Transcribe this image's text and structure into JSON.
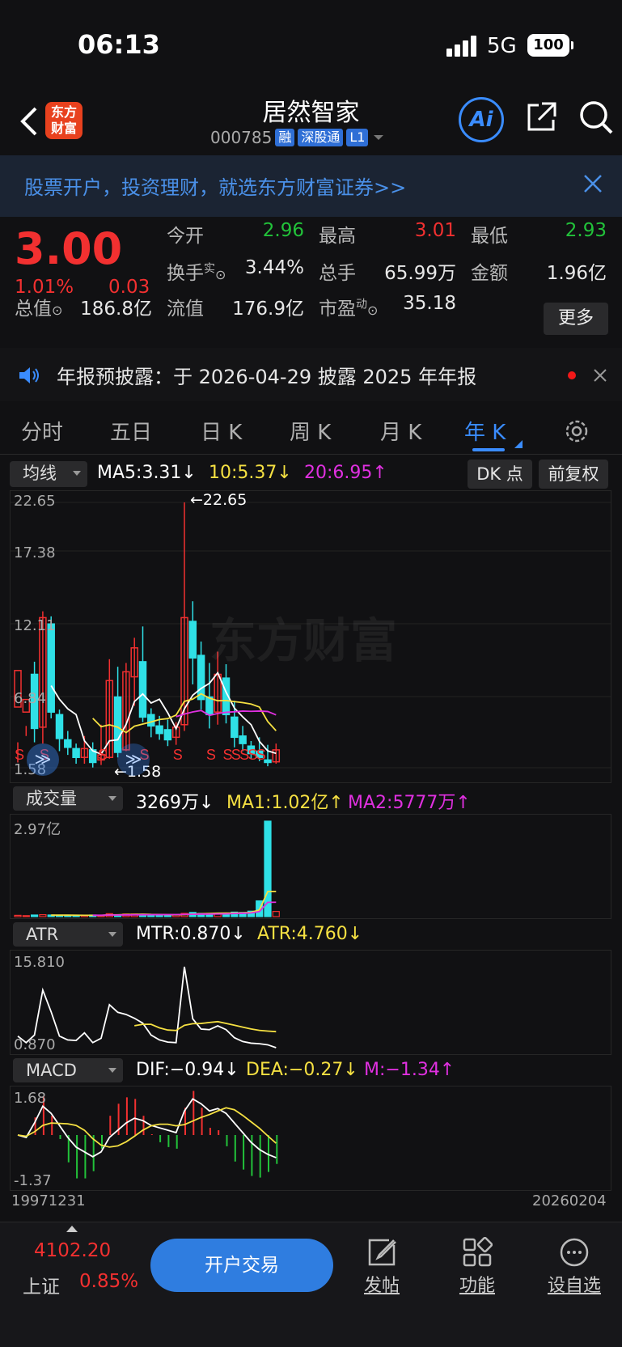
{
  "status": {
    "time": "06:13",
    "network": "5G",
    "battery": "100"
  },
  "nav": {
    "name": "居然智家",
    "code": "000785",
    "tags": [
      "融",
      "深股通",
      "L1"
    ],
    "ai": "Ai",
    "logo_line1": "东方",
    "logo_line2": "财富"
  },
  "banner": {
    "text": "股票开户，投资理财，就选东方财富证券>>"
  },
  "quote": {
    "price": "3.00",
    "change_pct": "1.01%",
    "change": "0.03",
    "open_label": "今开",
    "open": "2.96",
    "high_label": "最高",
    "high": "3.01",
    "low_label": "最低",
    "low": "2.93",
    "turnover_label": "换手",
    "turnover_sup": "实",
    "turnover": "3.44%",
    "volume_label": "总手",
    "volume": "65.99万",
    "amount_label": "金额",
    "amount": "1.96亿",
    "mcap_label": "总值",
    "mcap": "186.8亿",
    "float_label": "流值",
    "float": "176.9亿",
    "pe_label": "市盈",
    "pe_sup": "动",
    "pe": "35.18",
    "more": "更多"
  },
  "notice": {
    "text": "年报预披露：于 2026-04-29 披露 2025 年年报"
  },
  "tabs": [
    "分时",
    "五日",
    "日 K",
    "周 K",
    "月 K",
    "年 K"
  ],
  "kline": {
    "ma_select": "均线",
    "ma5": "MA5:3.31↓",
    "ma10": "10:5.37↓",
    "ma20": "20:6.95↑",
    "dk": "DK 点",
    "fq": "前复权",
    "y_labels": [
      "22.65",
      "17.38",
      "12.11",
      "6.84",
      "1.58"
    ],
    "high_note": "←22.65",
    "low_note": "←1.58",
    "watermark": "东方财富"
  },
  "volume": {
    "select": "成交量",
    "value": "3269万↓",
    "ma1": "MA1:1.02亿↑",
    "ma2": "MA2:5777万↑",
    "max": "2.97亿"
  },
  "atr": {
    "select": "ATR",
    "mtr": "MTR:0.870↓",
    "atr": "ATR:4.760↓",
    "max": "15.810",
    "min": "0.870"
  },
  "macd": {
    "select": "MACD",
    "dif": "DIF:−0.94↓",
    "dea": "DEA:−0.27↓",
    "m": "M:−1.34↑",
    "max": "1.68",
    "min": "-1.37"
  },
  "dates": {
    "start": "19971231",
    "end": "20260204"
  },
  "bottom": {
    "index_value": "4102.20",
    "index_name": "上证",
    "index_pct": "0.85%",
    "open_trade": "开户交易",
    "post": "发帖",
    "func": "功能",
    "watch": "设自选"
  },
  "colors": {
    "up": "#f23030",
    "down": "#22c23a",
    "accent": "#3a8cff",
    "candle_down": "#2fe0e6"
  },
  "chart_data": {
    "type": "candlestick",
    "candles": [
      [
        6.4,
        9.3,
        3.6,
        2.0
      ],
      [
        6.0,
        7.0,
        4.1,
        4.9
      ],
      [
        9.0,
        4.7,
        3.6,
        10.0
      ],
      [
        4.8,
        13.5,
        3.5,
        14.0
      ],
      [
        13.0,
        6.0,
        5.5,
        13.6
      ],
      [
        5.8,
        3.9,
        2.9,
        6.2
      ],
      [
        3.8,
        3.2,
        2.6,
        4.5
      ],
      [
        3.1,
        2.4,
        1.9,
        3.5
      ],
      [
        2.4,
        3.1,
        1.9,
        4.1
      ],
      [
        3.0,
        2.0,
        1.6,
        3.6
      ],
      [
        2.2,
        2.6,
        1.8,
        5.0
      ],
      [
        2.4,
        8.5,
        2.3,
        10.2
      ],
      [
        7.2,
        2.8,
        2.4,
        9.6
      ],
      [
        3.0,
        9.2,
        2.9,
        9.9
      ],
      [
        8.8,
        11.1,
        6.5,
        11.9
      ],
      [
        10.0,
        5.6,
        5.2,
        12.8
      ],
      [
        5.8,
        4.9,
        4.0,
        6.3
      ],
      [
        4.9,
        4.3,
        3.8,
        5.7
      ],
      [
        4.6,
        3.8,
        3.3,
        5.4
      ],
      [
        4.0,
        4.8,
        3.4,
        5.2
      ],
      [
        5.0,
        13.5,
        4.5,
        22.65
      ],
      [
        13.2,
        10.3,
        8.2,
        14.8
      ],
      [
        10.5,
        7.0,
        6.2,
        11.6
      ],
      [
        7.2,
        5.8,
        4.7,
        9.9
      ],
      [
        6.0,
        9.0,
        5.0,
        10.8
      ],
      [
        8.7,
        5.8,
        5.1,
        9.8
      ],
      [
        5.6,
        4.0,
        3.2,
        6.9
      ],
      [
        4.1,
        3.5,
        2.9,
        4.9
      ],
      [
        3.3,
        2.7,
        2.3,
        3.7
      ],
      [
        2.9,
        2.4,
        2.1,
        4.0
      ],
      [
        2.2,
        2.0,
        1.7,
        3.4
      ],
      [
        2.05,
        3.0,
        1.9,
        3.5
      ]
    ]
  }
}
